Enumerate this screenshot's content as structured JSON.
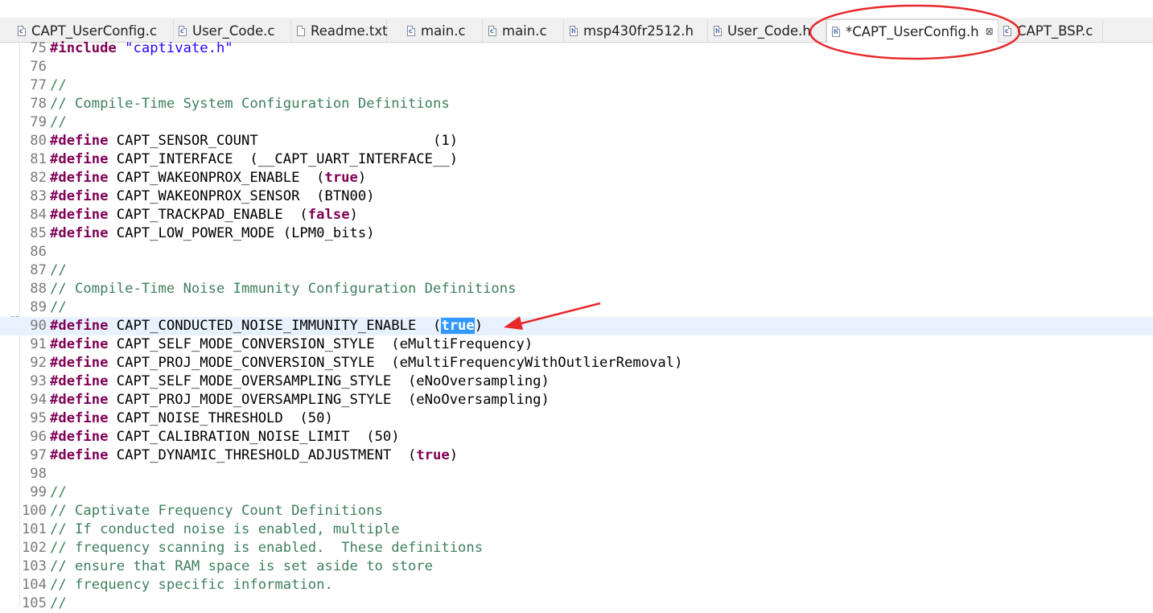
{
  "tabs": [
    {
      "label": "CAPT_UserConfig.c",
      "icon": "c-file-icon",
      "active": false
    },
    {
      "label": "User_Code.c",
      "icon": "c-file-icon",
      "active": false
    },
    {
      "label": "Readme.txt",
      "icon": "text-file-icon",
      "active": false
    },
    {
      "label": "main.c",
      "icon": "c-file-icon",
      "active": false
    },
    {
      "label": "main.c",
      "icon": "c-file-icon",
      "active": false
    },
    {
      "label": "msp430fr2512.h",
      "icon": "h-file-icon",
      "active": false
    },
    {
      "label": "User_Code.h",
      "icon": "h-file-icon",
      "active": false
    },
    {
      "label": "*CAPT_UserConfig.h",
      "icon": "h-file-icon",
      "active": true,
      "close": "⊠"
    },
    {
      "label": "CAPT_BSP.c",
      "icon": "c-file-icon",
      "active": false
    }
  ],
  "lines": [
    {
      "n": "75",
      "t": [
        {
          "k": "kw",
          "v": "#include"
        },
        {
          "k": "",
          "v": " "
        },
        {
          "k": "str",
          "v": "\"captivate.h\""
        }
      ]
    },
    {
      "n": "76",
      "t": []
    },
    {
      "n": "77",
      "t": [
        {
          "k": "cm",
          "v": "//"
        }
      ]
    },
    {
      "n": "78",
      "t": [
        {
          "k": "cm",
          "v": "// Compile-Time System Configuration Definitions"
        }
      ]
    },
    {
      "n": "79",
      "t": [
        {
          "k": "cm",
          "v": "//"
        }
      ]
    },
    {
      "n": "80",
      "t": [
        {
          "k": "kw",
          "v": "#define"
        },
        {
          "k": "",
          "v": " CAPT_SENSOR_COUNT                     (1)"
        }
      ]
    },
    {
      "n": "81",
      "t": [
        {
          "k": "kw",
          "v": "#define"
        },
        {
          "k": "",
          "v": " CAPT_INTERFACE  (__CAPT_UART_INTERFACE__)"
        }
      ]
    },
    {
      "n": "82",
      "t": [
        {
          "k": "kw",
          "v": "#define"
        },
        {
          "k": "",
          "v": " CAPT_WAKEONPROX_ENABLE  ("
        },
        {
          "k": "kw",
          "v": "true"
        },
        {
          "k": "",
          "v": ")"
        }
      ]
    },
    {
      "n": "83",
      "t": [
        {
          "k": "kw",
          "v": "#define"
        },
        {
          "k": "",
          "v": " CAPT_WAKEONPROX_SENSOR  (BTN00)"
        }
      ]
    },
    {
      "n": "84",
      "t": [
        {
          "k": "kw",
          "v": "#define"
        },
        {
          "k": "",
          "v": " CAPT_TRACKPAD_ENABLE  ("
        },
        {
          "k": "kw",
          "v": "false"
        },
        {
          "k": "",
          "v": ")"
        }
      ]
    },
    {
      "n": "85",
      "t": [
        {
          "k": "kw",
          "v": "#define"
        },
        {
          "k": "",
          "v": " CAPT_LOW_POWER_MODE (LPM0_bits)"
        }
      ]
    },
    {
      "n": "86",
      "t": []
    },
    {
      "n": "87",
      "t": [
        {
          "k": "cm",
          "v": "//"
        }
      ]
    },
    {
      "n": "88",
      "t": [
        {
          "k": "cm",
          "v": "// Compile-Time Noise Immunity Configuration Definitions"
        }
      ]
    },
    {
      "n": "89",
      "t": [
        {
          "k": "cm",
          "v": "//"
        }
      ]
    },
    {
      "n": "90",
      "current": true,
      "t": [
        {
          "k": "kw",
          "v": "#define"
        },
        {
          "k": "",
          "v": " CAPT_CONDUCTED_NOISE_IMMUNITY_ENABLE  ("
        },
        {
          "k": "sel",
          "v": "true"
        },
        {
          "k": "",
          "v": ")"
        }
      ]
    },
    {
      "n": "91",
      "t": [
        {
          "k": "kw",
          "v": "#define"
        },
        {
          "k": "",
          "v": " CAPT_SELF_MODE_CONVERSION_STYLE  (eMultiFrequency)"
        }
      ]
    },
    {
      "n": "92",
      "t": [
        {
          "k": "kw",
          "v": "#define"
        },
        {
          "k": "",
          "v": " CAPT_PROJ_MODE_CONVERSION_STYLE  (eMultiFrequencyWithOutlierRemoval)"
        }
      ]
    },
    {
      "n": "93",
      "t": [
        {
          "k": "kw",
          "v": "#define"
        },
        {
          "k": "",
          "v": " CAPT_SELF_MODE_OVERSAMPLING_STYLE  (eNoOversampling)"
        }
      ]
    },
    {
      "n": "94",
      "t": [
        {
          "k": "kw",
          "v": "#define"
        },
        {
          "k": "",
          "v": " CAPT_PROJ_MODE_OVERSAMPLING_STYLE  (eNoOversampling)"
        }
      ]
    },
    {
      "n": "95",
      "t": [
        {
          "k": "kw",
          "v": "#define"
        },
        {
          "k": "",
          "v": " CAPT_NOISE_THRESHOLD  (50)"
        }
      ]
    },
    {
      "n": "96",
      "t": [
        {
          "k": "kw",
          "v": "#define"
        },
        {
          "k": "",
          "v": " CAPT_CALIBRATION_NOISE_LIMIT  (50)"
        }
      ]
    },
    {
      "n": "97",
      "t": [
        {
          "k": "kw",
          "v": "#define"
        },
        {
          "k": "",
          "v": " CAPT_DYNAMIC_THRESHOLD_ADJUSTMENT  ("
        },
        {
          "k": "kw",
          "v": "true"
        },
        {
          "k": "",
          "v": ")"
        }
      ]
    },
    {
      "n": "98",
      "t": []
    },
    {
      "n": "99",
      "t": [
        {
          "k": "cm",
          "v": "//"
        }
      ]
    },
    {
      "n": "100",
      "t": [
        {
          "k": "cm",
          "v": "// Captivate Frequency Count Definitions"
        }
      ]
    },
    {
      "n": "101",
      "t": [
        {
          "k": "cm",
          "v": "// If conducted noise is enabled, multiple"
        }
      ]
    },
    {
      "n": "102",
      "t": [
        {
          "k": "cm",
          "v": "// frequency scanning is enabled.  These definitions"
        }
      ]
    },
    {
      "n": "103",
      "t": [
        {
          "k": "cm",
          "v": "// ensure that RAM space is set aside to store"
        }
      ]
    },
    {
      "n": "104",
      "t": [
        {
          "k": "cm",
          "v": "// frequency specific information."
        }
      ]
    },
    {
      "n": "105",
      "t": [
        {
          "k": "cm",
          "v": "//"
        }
      ]
    }
  ],
  "colors": {
    "keyword": "#7f0055",
    "comment": "#3f7f5f",
    "string": "#2a00ff",
    "selection": "#3399ff",
    "current_line": "#e8f2fe",
    "annotation": "#e8282b"
  }
}
